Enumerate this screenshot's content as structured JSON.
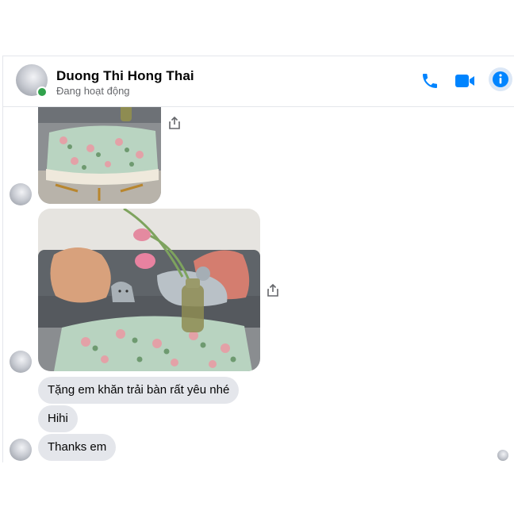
{
  "contact": {
    "name": "Duong Thi Hong Thai",
    "status": "Đang hoạt động"
  },
  "header": {
    "icons": [
      "phone-icon",
      "video-camera-icon",
      "info-icon"
    ],
    "accent_color": "#0084ff"
  },
  "messages": [
    {
      "type": "image",
      "description_icon": "photo"
    },
    {
      "type": "image",
      "description_icon": "photo"
    },
    {
      "type": "text",
      "text": "Tặng em khăn trải bàn rất yêu nhé"
    },
    {
      "type": "text",
      "text": "Hihi"
    },
    {
      "type": "text",
      "text": "Thanks em"
    }
  ],
  "colors": {
    "bubble_bg": "#e4e6eb",
    "online": "#31a24c",
    "tablecloth": "#b8d3c0",
    "sofa": "#5f6469"
  }
}
